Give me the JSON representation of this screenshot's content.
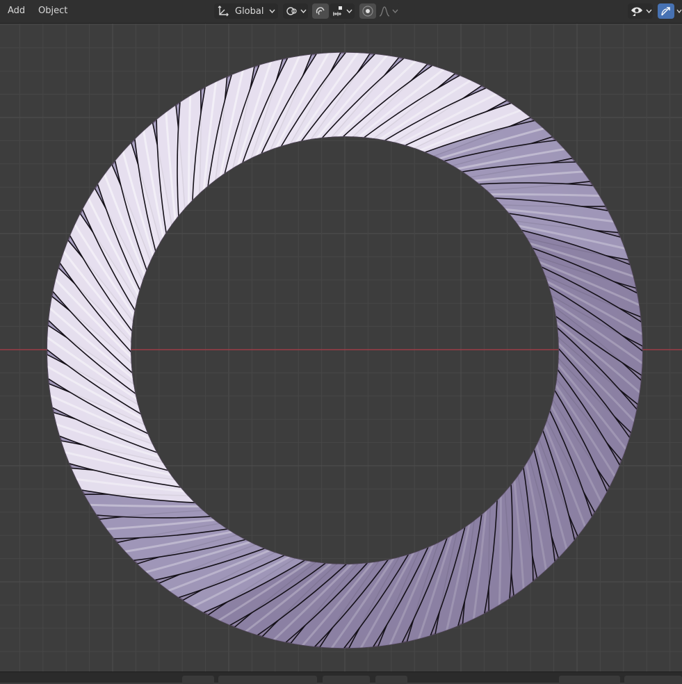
{
  "menu": {
    "add_label": "Add",
    "object_label": "Object"
  },
  "toolbar": {
    "orientation_label": "Global",
    "orientation_icon": "transform-orientation-icon",
    "pivot_icon": "pivot-point-icon",
    "snap_icon": "snap-magnet-icon",
    "snap_target_icon": "snap-increment-icon",
    "proportional_icon": "proportional-editing-icon",
    "falloff_icon": "falloff-curve-icon",
    "visibility_icon": "eye-icon",
    "gizmo_icon": "gizmo-icon"
  },
  "colors": {
    "viewport_bg": "#3d3d3d",
    "grid_minor": "#474747",
    "grid_major": "#4f4f4f",
    "x_axis": "#9b3c46",
    "header_bg": "#303030",
    "accent": "#4772b3",
    "rope_light": "#eae4f2",
    "rope_mid": "#9f97b8",
    "rope_dark": "#5a4a66"
  },
  "scene": {
    "object": "twisted-rope-torus"
  }
}
